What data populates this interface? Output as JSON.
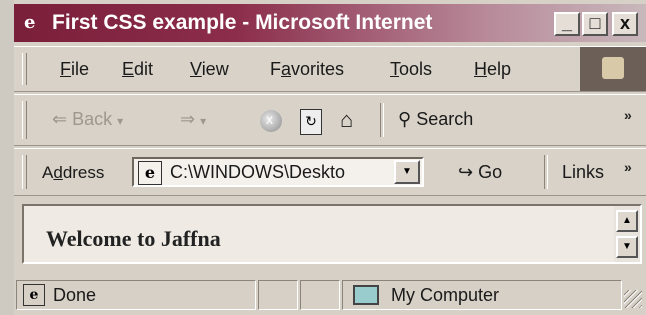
{
  "window": {
    "title": "First CSS example - Microsoft Internet",
    "controls": {
      "minimize": "_",
      "maximize": "□",
      "close": "x"
    },
    "app_icon": "ie-logo-icon"
  },
  "menu": {
    "items": [
      {
        "label": "File",
        "accel": "F",
        "rest": "ile"
      },
      {
        "label": "Edit",
        "accel": "E",
        "rest": "dit"
      },
      {
        "label": "View",
        "accel": "V",
        "rest": "iew"
      },
      {
        "label": "Favorites",
        "pre": "F",
        "accel": "a",
        "rest": "vorites"
      },
      {
        "label": "Tools",
        "accel": "T",
        "rest": "ools"
      },
      {
        "label": "Help",
        "accel": "H",
        "rest": "elp"
      }
    ]
  },
  "toolbar": {
    "back_label": "Back",
    "search_label": "Search",
    "more": "»",
    "icons": [
      "back-arrow-icon",
      "forward-arrow-icon",
      "stop-icon",
      "refresh-icon",
      "home-icon",
      "search-icon"
    ]
  },
  "address": {
    "label": "Address",
    "label_accel": "d",
    "value": "C:\\WINDOWS\\Deskto",
    "go_label": "Go",
    "links_label": "Links",
    "more": "»"
  },
  "content": {
    "heading": "Welcome to Jaffna"
  },
  "status": {
    "text": "Done",
    "zone": "My Computer"
  },
  "colors": {
    "titlebar_start": "#7a1f3a",
    "titlebar_end": "#c8b8bc",
    "chrome": "#d6d0c6"
  }
}
